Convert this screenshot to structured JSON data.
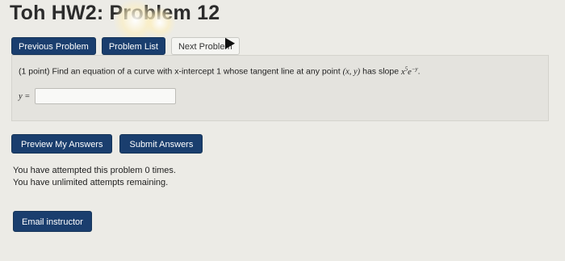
{
  "title": "Toh HW2: Problem 12",
  "nav": {
    "previous": "Previous Problem",
    "list": "Problem List",
    "next": "Next Problem"
  },
  "problem": {
    "points": "(1 point)",
    "text": "Find an equation of a curve with x-intercept 1 whose tangent line at any point",
    "point": "(x, y)",
    "slope_text": "has slope",
    "slope_expr_base": "x",
    "slope_expr_exp": "5",
    "slope_expr_e": "e",
    "slope_expr_e_exp": "−y",
    "period": ".",
    "answer_label": "y =",
    "answer_value": ""
  },
  "actions": {
    "preview": "Preview My Answers",
    "submit": "Submit Answers"
  },
  "messages": {
    "attempted": "You have attempted this problem 0 times.",
    "remaining": "You have unlimited attempts remaining."
  },
  "email": {
    "label": "Email instructor"
  },
  "colors": {
    "primary_button": "#1a3e6e",
    "background": "#ecebe6"
  }
}
